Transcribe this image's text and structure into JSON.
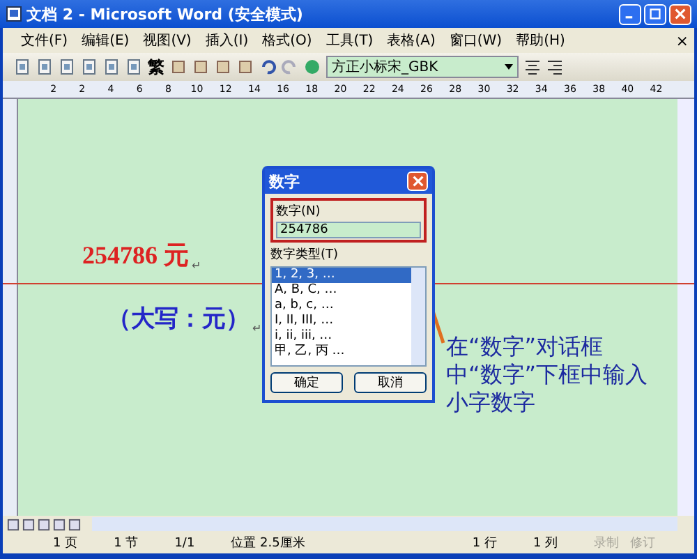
{
  "window": {
    "title": "文档 2 - Microsoft Word (安全模式)"
  },
  "menu": {
    "items": [
      "文件(F)",
      "编辑(E)",
      "视图(V)",
      "插入(I)",
      "格式(O)",
      "工具(T)",
      "表格(A)",
      "窗口(W)",
      "帮助(H)"
    ],
    "close": "×"
  },
  "toolbar": {
    "convert_button": "繁",
    "font": "方正小标宋_GBK"
  },
  "ruler": {
    "ticks": [
      "2",
      "2",
      "4",
      "6",
      "8",
      "10",
      "12",
      "14",
      "16",
      "18",
      "20",
      "22",
      "24",
      "26",
      "28",
      "30",
      "32",
      "34",
      "36",
      "38",
      "40",
      "42"
    ]
  },
  "document": {
    "amount": "254786 元",
    "amount_mark": "↵",
    "uppercase": "（大写：元）",
    "uppercase_mark": "↵"
  },
  "dialog": {
    "title": "数字",
    "field_label": "数字(N)",
    "field_value": "254786",
    "list_label": "数字类型(T)",
    "types": [
      {
        "label": "1, 2, 3, …",
        "selected": true
      },
      {
        "label": "A, B, C, …",
        "selected": false
      },
      {
        "label": "a, b, c, …",
        "selected": false
      },
      {
        "label": "I, II, III, …",
        "selected": false
      },
      {
        "label": "i, ii, iii, …",
        "selected": false
      },
      {
        "label": "甲, 乙, 丙 …",
        "selected": false
      }
    ],
    "buttons": [
      "确定",
      "取消"
    ]
  },
  "annotation": "在“数字”对话框中“数字”下框中输入小字数字",
  "status_bar": [
    {
      "text": "1 页",
      "dimmed": false
    },
    {
      "text": "1 节",
      "dimmed": false
    },
    {
      "text": "1/1",
      "dimmed": false
    },
    {
      "text": "位置 2.5厘米",
      "dimmed": false
    },
    {
      "text": "1 行",
      "dimmed": false
    },
    {
      "text": "1 列",
      "dimmed": false
    },
    {
      "text": "录制",
      "dimmed": true
    },
    {
      "text": "修订",
      "dimmed": true
    }
  ]
}
